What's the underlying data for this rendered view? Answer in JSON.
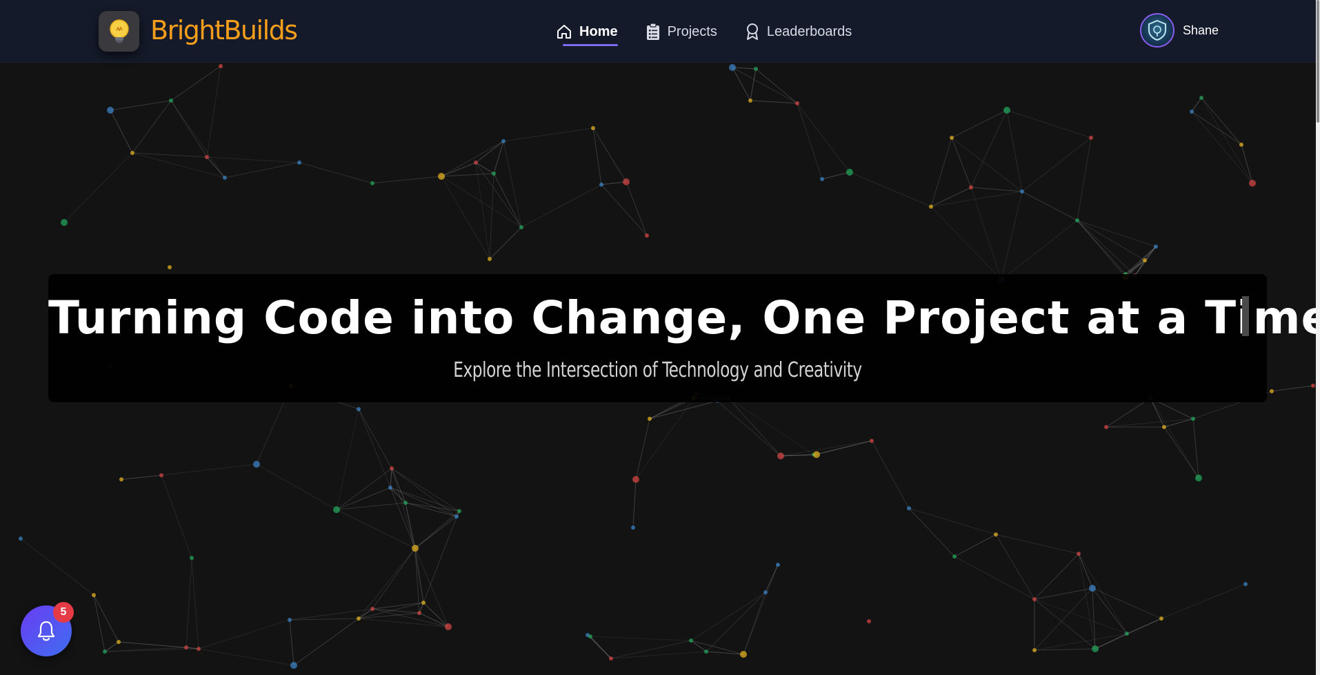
{
  "nav": {
    "brand": "BrightBuilds",
    "links": [
      {
        "label": "Home",
        "icon": "home-icon",
        "active": true
      },
      {
        "label": "Projects",
        "icon": "clipboard-list-icon",
        "active": false
      },
      {
        "label": "Leaderboards",
        "icon": "award-icon",
        "active": false
      }
    ],
    "user_name": "Shane"
  },
  "hero": {
    "title": "Turning Code into Change, One Project at a Time.",
    "subtitle": "Explore the Intersection of Technology and Creativity"
  },
  "notifications": {
    "count": "5"
  },
  "theme": {
    "accent": "#7c6cf0",
    "brand_color": "#f59e1b",
    "badge_color": "#e43b47",
    "node_colors": [
      "#3b82c4",
      "#22a35a",
      "#e0b020",
      "#d24545"
    ]
  }
}
